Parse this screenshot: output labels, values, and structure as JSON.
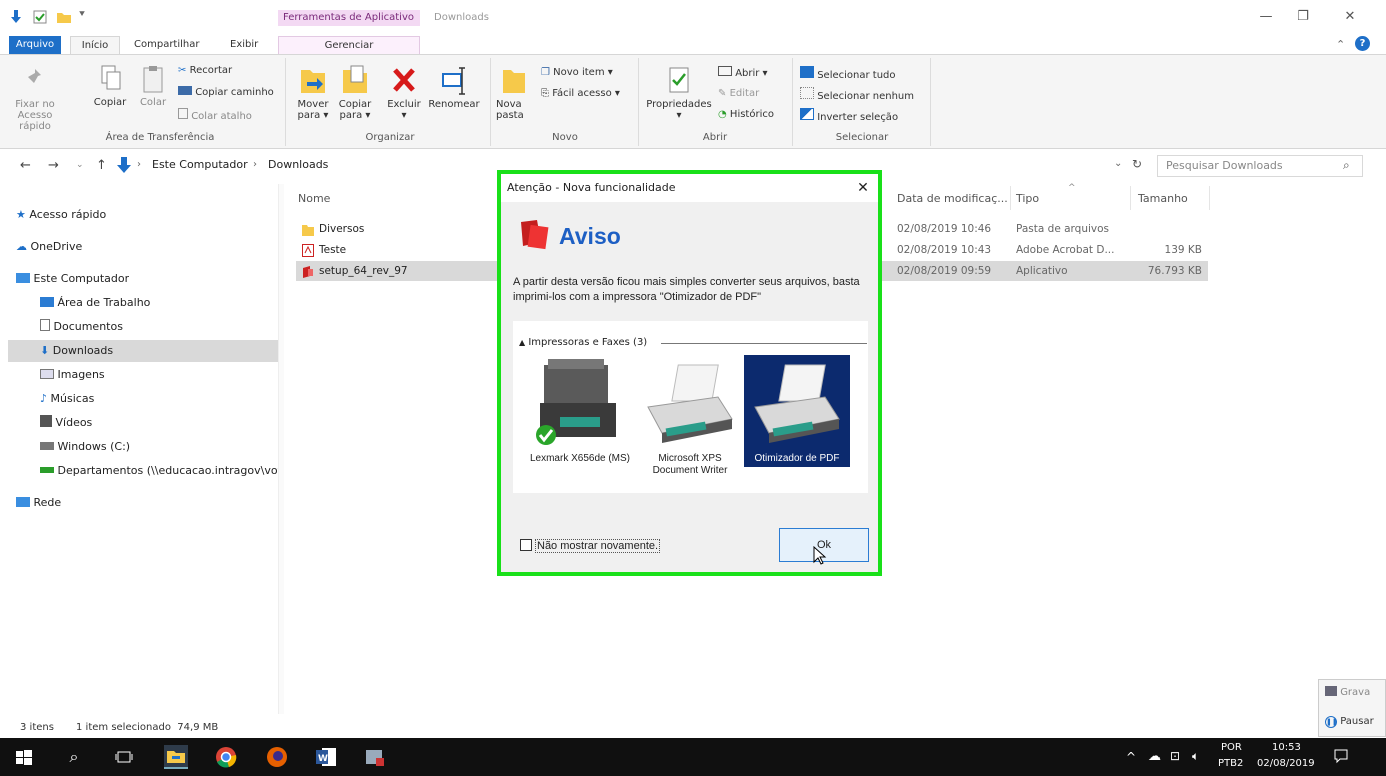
{
  "window": {
    "title": "Downloads",
    "context_tab_group": "Ferramentas de Aplicativo"
  },
  "tabs": {
    "arquivo": "Arquivo",
    "inicio": "Início",
    "compartilhar": "Compartilhar",
    "exibir": "Exibir",
    "gerenciar": "Gerenciar"
  },
  "ribbon": {
    "area_transferencia": {
      "label": "Área de Transferência",
      "fixar": "Fixar no Acesso rápido",
      "copiar": "Copiar",
      "colar": "Colar",
      "recortar": "Recortar",
      "copiar_caminho": "Copiar caminho",
      "colar_atalho": "Colar atalho"
    },
    "organizar": {
      "label": "Organizar",
      "mover": "Mover para ▾",
      "copiar": "Copiar para ▾",
      "excluir": "Excluir ▾",
      "renomear": "Renomear"
    },
    "novo": {
      "label": "Novo",
      "nova_pasta": "Nova pasta",
      "novo_item": "Novo item ▾",
      "facil_acesso": "Fácil acesso ▾"
    },
    "abrir": {
      "label": "Abrir",
      "propriedades": "Propriedades ▾",
      "abrir": "Abrir ▾",
      "editar": "Editar",
      "historico": "Histórico"
    },
    "selecionar": {
      "label": "Selecionar",
      "tudo": "Selecionar tudo",
      "nenhum": "Selecionar nenhum",
      "inverter": "Inverter seleção"
    }
  },
  "address": {
    "crumb1": "Este Computador",
    "crumb2": "Downloads",
    "search_placeholder": "Pesquisar Downloads"
  },
  "nav": {
    "acesso_rapido": "Acesso rápido",
    "onedrive": "OneDrive",
    "este_computador": "Este Computador",
    "area_trabalho": "Área de Trabalho",
    "documentos": "Documentos",
    "downloads": "Downloads",
    "imagens": "Imagens",
    "musicas": "Músicas",
    "videos": "Vídeos",
    "windows_c": "Windows (C:)",
    "departamentos": "Departamentos (\\\\educacao.intragov\\vot",
    "rede": "Rede"
  },
  "columns": {
    "nome": "Nome",
    "data": "Data de modificaç...",
    "tipo": "Tipo",
    "tamanho": "Tamanho"
  },
  "files": [
    {
      "name": "Diversos",
      "date": "02/08/2019 10:46",
      "type": "Pasta de arquivos",
      "size": ""
    },
    {
      "name": "Teste",
      "date": "02/08/2019 10:43",
      "type": "Adobe Acrobat D...",
      "size": "139 KB"
    },
    {
      "name": "setup_64_rev_97",
      "date": "02/08/2019 09:59",
      "type": "Aplicativo",
      "size": "76.793 KB"
    }
  ],
  "status": {
    "items": "3 itens",
    "selected": "1 item selecionado  74,9 MB"
  },
  "dialog": {
    "title": "Atenção - Nova funcionalidade",
    "heading": "Aviso",
    "message": "A partir desta versão ficou mais simples converter seus arquivos, basta imprimi-los com a impressora \"Otimizador de PDF\"",
    "group_header": "Impressoras e Faxes (3)",
    "printers": [
      "Lexmark X656de (MS)",
      "Microsoft XPS Document Writer",
      "Otimizador de PDF"
    ],
    "checkbox": "Não mostrar novamente.",
    "ok": "Ok"
  },
  "recorder": {
    "record": "Grava",
    "pause": "Pausar"
  },
  "taskbar": {
    "lang1": "POR",
    "lang2": "PTB2",
    "time": "10:53",
    "date": "02/08/2019"
  },
  "colors": {
    "accent": "#1e6fc8",
    "dialog_border": "#19e019",
    "selected_printer": "#0c2a6e"
  }
}
